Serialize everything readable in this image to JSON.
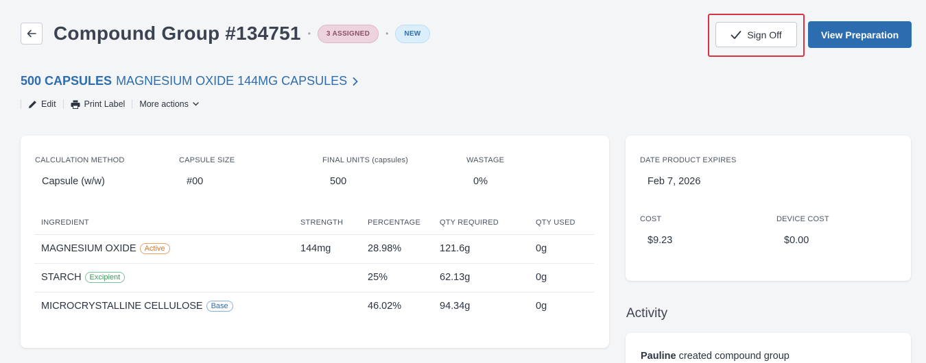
{
  "header": {
    "title": "Compound Group #134751",
    "badge_assigned": "3 ASSIGNED",
    "badge_new": "NEW",
    "signoff_label": "Sign Off",
    "view_label": "View Preparation"
  },
  "product": {
    "quantity": "500 CAPSULES",
    "name": "MAGNESIUM OXIDE 144MG CAPSULES"
  },
  "actions": {
    "edit": "Edit",
    "print": "Print Label",
    "more": "More actions"
  },
  "calc": {
    "method_label": "CALCULATION METHOD",
    "method_value": "Capsule (w/w)",
    "size_label": "CAPSULE SIZE",
    "size_value": "#00",
    "units_label": "FINAL UNITS (capsules)",
    "units_value": "500",
    "wastage_label": "WASTAGE",
    "wastage_value": "0%"
  },
  "ingredients": {
    "columns": [
      "INGREDIENT",
      "STRENGTH",
      "PERCENTAGE",
      "QTY REQUIRED",
      "QTY USED"
    ],
    "rows": [
      {
        "name": "MAGNESIUM OXIDE",
        "tag": "Active",
        "strength": "144mg",
        "percentage": "28.98%",
        "qty_required": "121.6g",
        "qty_used": "0g"
      },
      {
        "name": "STARCH",
        "tag": "Excipient",
        "strength": "",
        "percentage": "25%",
        "qty_required": "62.13g",
        "qty_used": "0g"
      },
      {
        "name": "MICROCRYSTALLINE CELLULOSE",
        "tag": "Base",
        "strength": "",
        "percentage": "46.02%",
        "qty_required": "94.34g",
        "qty_used": "0g"
      }
    ]
  },
  "side": {
    "expires_label": "DATE PRODUCT EXPIRES",
    "expires_value": "Feb 7, 2026",
    "cost_label": "COST",
    "cost_value": "$9.23",
    "device_cost_label": "DEVICE COST",
    "device_cost_value": "$0.00"
  },
  "activity": {
    "title": "Activity",
    "user": "Pauline",
    "text": "created compound group"
  },
  "colors": {
    "primary": "#2c6db0",
    "highlight": "#d93240",
    "active_tag": "#d9782a",
    "excipient_tag": "#3d9a5a"
  }
}
